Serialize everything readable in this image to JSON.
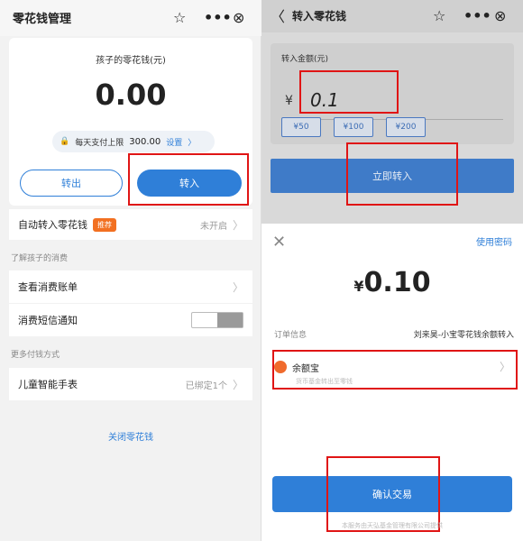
{
  "left": {
    "title": "零花钱管理",
    "icons": [
      "star-icon",
      "more-icon",
      "close-circle-icon"
    ],
    "balance_label": "孩子的零花钱(元)",
    "balance": "0.00",
    "limit_label": "每天支付上限",
    "limit_value": "300.00",
    "limit_setting": "设置",
    "btn_out": "转出",
    "btn_in": "转入",
    "auto_row": {
      "label": "自动转入零花钱",
      "badge": "推荐",
      "status": "未开启"
    },
    "section1": "了解孩子的消费",
    "bill_row": "查看消费账单",
    "sms_row": "消费短信通知",
    "section2": "更多付钱方式",
    "watch_row": {
      "label": "儿童智能手表",
      "status": "已绑定1个"
    },
    "close_link": "关闭零花钱"
  },
  "right": {
    "title": "转入零花钱",
    "amount_label": "转入金额(元)",
    "currency": "¥",
    "amount_input": "0.1",
    "chips": [
      "¥50",
      "¥100",
      "¥200"
    ],
    "btn_now": "立即转入",
    "sheet": {
      "use_password": "使用密码",
      "amount_currency": "¥",
      "amount": "0.10",
      "order_label": "订单信息",
      "order_value": "刘来昊-小宝零花钱余额转入",
      "pay_method": "余额宝",
      "pay_sub": "货币基金转出至零钱",
      "confirm": "确认交易",
      "footer": "本服务由天弘基金管理有限公司提供"
    }
  },
  "colors": {
    "accent": "#2f7fd8",
    "badge": "#f27021",
    "annotation": "#e01515"
  }
}
